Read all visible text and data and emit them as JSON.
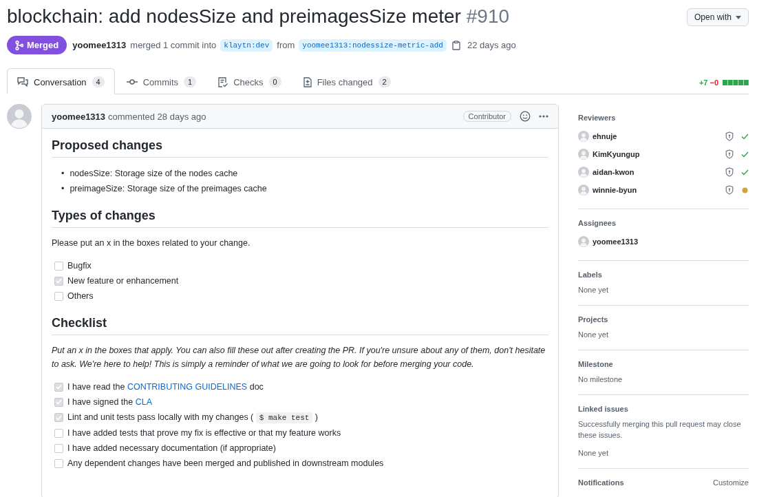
{
  "title": {
    "text": "blockchain: add nodesSize and preimagesSize meter",
    "number": "#910"
  },
  "open_with": "Open with",
  "state_badge": {
    "label": "Merged",
    "kind": "merged"
  },
  "merge_info": {
    "author": "yoomee1313",
    "text": "merged 1 commit into",
    "base": "klaytn:dev",
    "from": "from",
    "head": "yoomee1313:nodessize-metric-add",
    "time": "22 days ago"
  },
  "tabs": [
    {
      "label": "Conversation",
      "count": "4",
      "selected": true,
      "kind": "conversation"
    },
    {
      "label": "Commits",
      "count": "1",
      "selected": false,
      "kind": "commits"
    },
    {
      "label": "Checks",
      "count": "0",
      "selected": false,
      "kind": "checks"
    },
    {
      "label": "Files changed",
      "count": "2",
      "selected": false,
      "kind": "files"
    }
  ],
  "diffstat": {
    "additions": "+7",
    "deletions": "−0"
  },
  "comment": {
    "author": "yoomee1313",
    "meta": "commented 28 days ago",
    "badge": "Contributor",
    "sections": [
      {
        "heading": "Proposed changes",
        "items": [
          {
            "kind": "bullet",
            "marker": "•",
            "parts": [
              {
                "text": "nodesSize: Storage size of the nodes cache"
              }
            ]
          },
          {
            "kind": "bullet",
            "marker": "•",
            "parts": [
              {
                "text": "preimageSize: Storage size of the preimages cache"
              }
            ]
          }
        ]
      },
      {
        "heading": "Types of changes",
        "intro": "Please put an x in the boxes related to your change.",
        "intro_italic": false,
        "items": [
          {
            "kind": "task",
            "checked": false,
            "parts": [
              {
                "text": "Bugfix"
              }
            ]
          },
          {
            "kind": "task",
            "checked": true,
            "parts": [
              {
                "text": "New feature or enhancement"
              }
            ]
          },
          {
            "kind": "task",
            "checked": false,
            "parts": [
              {
                "text": "Others"
              }
            ]
          }
        ]
      },
      {
        "heading": "Checklist",
        "intro": "Put an x in the boxes that apply. You can also fill these out after creating the PR. If you're unsure about any of them, don't hesitate to ask. We're here to help! This is simply a reminder of what we are going to look for before merging your code.",
        "intro_italic": true,
        "items": [
          {
            "kind": "task",
            "checked": true,
            "parts": [
              {
                "text": "I have read the "
              },
              {
                "text": "CONTRIBUTING GUIDELINES",
                "kind": "link"
              },
              {
                "text": " doc"
              }
            ]
          },
          {
            "kind": "task",
            "checked": true,
            "parts": [
              {
                "text": "I have signed the "
              },
              {
                "text": "CLA",
                "kind": "link"
              }
            ]
          },
          {
            "kind": "task",
            "checked": true,
            "parts": [
              {
                "text": "Lint and unit tests pass locally with my changes ( "
              },
              {
                "text": "$ make test",
                "kind": "code"
              },
              {
                "text": " )"
              }
            ]
          },
          {
            "kind": "task",
            "checked": false,
            "parts": [
              {
                "text": "I have added tests that prove my fix is effective or that my feature works"
              }
            ]
          },
          {
            "kind": "task",
            "checked": false,
            "parts": [
              {
                "text": "I have added necessary documentation (if appropriate)"
              }
            ]
          },
          {
            "kind": "task",
            "checked": false,
            "parts": [
              {
                "text": "Any dependent changes have been merged and published in downstream modules"
              }
            ]
          }
        ]
      }
    ]
  },
  "sidebar": [
    {
      "title": "Reviewers",
      "people": [
        {
          "name": "ehnuje",
          "approved": true
        },
        {
          "name": "KimKyungup",
          "approved": true
        },
        {
          "name": "aidan-kwon",
          "approved": true
        },
        {
          "name": "winnie-byun",
          "approved": false
        }
      ]
    },
    {
      "title": "Assignees",
      "people": [
        {
          "name": "yoomee1313"
        }
      ]
    },
    {
      "title": "Labels",
      "texts": [
        "None yet"
      ]
    },
    {
      "title": "Projects",
      "texts": [
        "None yet"
      ]
    },
    {
      "title": "Milestone",
      "texts": [
        "No milestone"
      ]
    },
    {
      "title": "Linked issues",
      "texts": [
        "Successfully merging this pull request may close these issues.",
        "None yet"
      ]
    },
    {
      "title": "Notifications",
      "action": "Customize"
    }
  ]
}
